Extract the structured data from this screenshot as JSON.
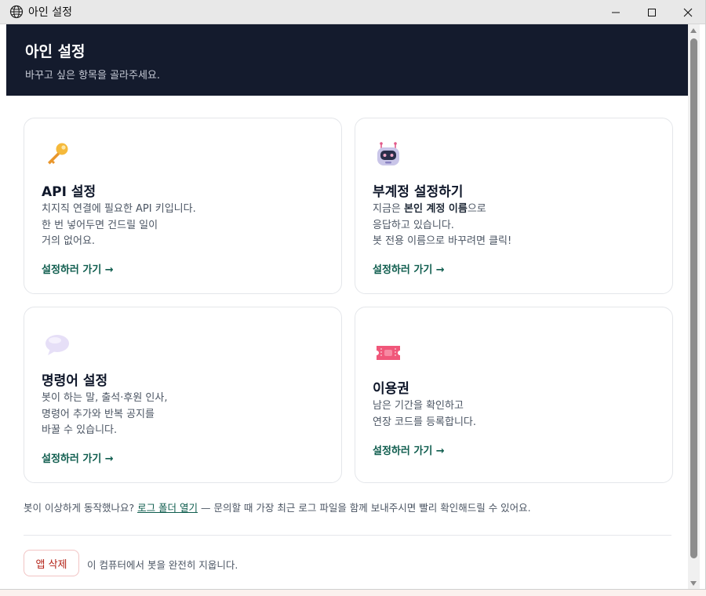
{
  "window": {
    "title": "아인 설정",
    "controls": {
      "minimize": "—",
      "maximize": "☐",
      "close": "✕"
    }
  },
  "hero": {
    "title": "아인 설정",
    "subtitle": "바꾸고 싶은 항목을 골라주세요."
  },
  "cards": [
    {
      "icon": "key-icon",
      "title": "API 설정",
      "desc_lines": [
        "치지직 연결에 필요한 API 키입니다.",
        "한 번 넣어두면 건드릴 일이",
        "거의 없어요."
      ],
      "link": "설정하러 가기 →"
    },
    {
      "icon": "robot-icon",
      "title": "부계정 설정하기",
      "desc_line1_pre": "지금은 ",
      "desc_line1_bold": "본인 계정 이름",
      "desc_line1_post": "으로",
      "desc_line2": "응답하고 있습니다.",
      "desc_line3": "봇 전용 이름으로 바꾸려면 클릭!",
      "link": "설정하러 가기 →"
    },
    {
      "icon": "speech-bubble-icon",
      "title": "명령어 설정",
      "desc_lines": [
        "봇이 하는 말, 출석·후원 인사,",
        "명령어 추가와 반복 공지를",
        "바꿀 수 있습니다."
      ],
      "link": "설정하러 가기 →"
    },
    {
      "icon": "ticket-icon",
      "title": "이용권",
      "desc_lines": [
        "남은 기간을 확인하고",
        "연장 코드를 등록합니다."
      ],
      "link": "설정하러 가기 →"
    }
  ],
  "footer": {
    "note_pre": "봇이 이상하게 동작했나요? ",
    "note_link": "로그 폴더 열기",
    "note_post": " — 문의할 때 가장 최근 로그 파일을 함께 보내주시면 빨리 확인해드릴 수 있어요.",
    "delete_label": "앱 삭제",
    "delete_desc": "이 컴퓨터에서 봇을 완전히 지웁니다."
  },
  "colors": {
    "hero_bg": "#141b2d",
    "link": "#0f5d4e",
    "danger": "#b42318"
  }
}
